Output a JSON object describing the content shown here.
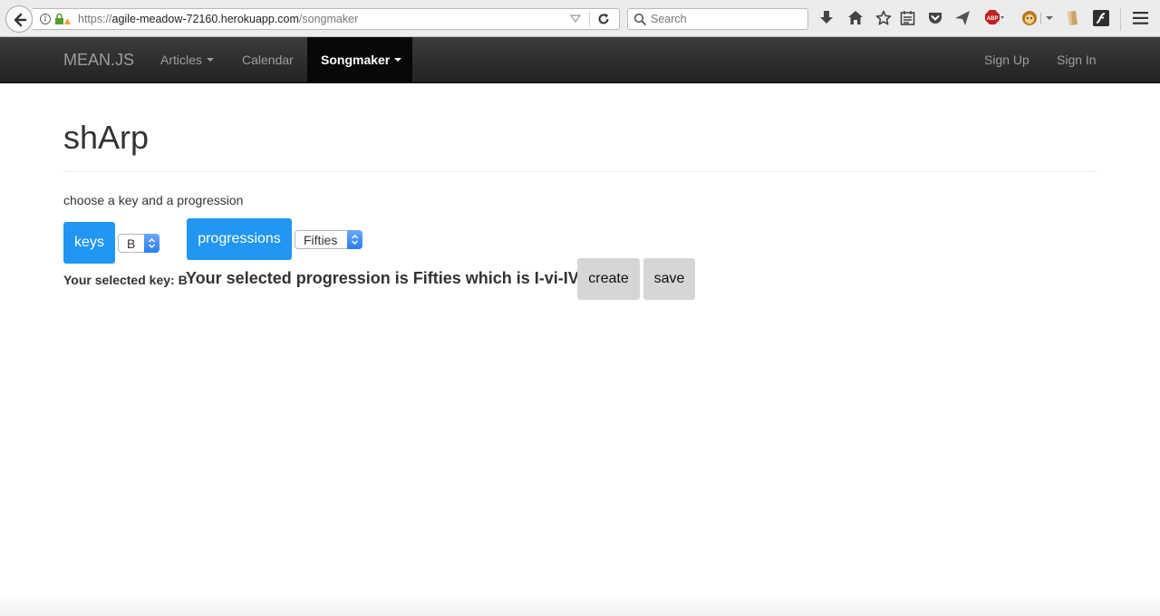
{
  "browser": {
    "url_host_prefix": "https://",
    "url_host": "agile-meadow-72160.herokuapp.com",
    "url_path": "/songmaker",
    "search_placeholder": "Search",
    "abp_label": "ABP"
  },
  "navbar": {
    "brand": "MEAN.JS",
    "items": [
      {
        "label": "Articles",
        "has_caret": true
      },
      {
        "label": "Calendar",
        "has_caret": false
      },
      {
        "label": "Songmaker",
        "has_caret": true,
        "active": true
      }
    ],
    "right_items": [
      {
        "label": "Sign Up"
      },
      {
        "label": "Sign In"
      }
    ]
  },
  "main": {
    "title": "shArp",
    "instructions": "choose a key and a progression",
    "keys_label": "keys",
    "key_select_value": "B",
    "progressions_label": "progressions",
    "progression_select_value": "Fifties",
    "selected_key_text": "Your selected key: B",
    "selected_progression_text": "Your selected progression is Fifties which is I-vi-IV-I",
    "create_label": "create",
    "save_label": "save"
  },
  "colors": {
    "accent_blue": "#2196f3",
    "navbar_bg": "#222222",
    "gray_button": "#d6d6d6"
  }
}
